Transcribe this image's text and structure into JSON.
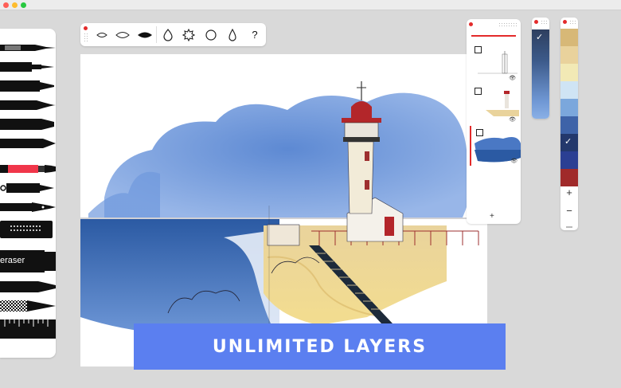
{
  "window": {
    "traffic_lights": [
      "close",
      "minimize",
      "zoom"
    ]
  },
  "brush_toolbar": {
    "brushes": [
      "brush-leaf-small-icon",
      "brush-leaf-outline-icon",
      "brush-leaf-filled-icon",
      "brush-drop-icon",
      "brush-splat-icon",
      "brush-circle-icon",
      "brush-teardrop-icon"
    ],
    "help_label": "?"
  },
  "tools": {
    "items": [
      "fineliner-icon",
      "technical-pen-icon",
      "marker-icon",
      "brush-pen-icon",
      "felt-tip-icon",
      "pencil-icon",
      "watercolor-brush-icon",
      "fountain-pen-icon",
      "nib-pen-icon",
      "texture-brush-icon",
      "eraser-icon",
      "chisel-marker-icon",
      "knife-icon",
      "ruler-icon"
    ],
    "eraser_label": "eraser",
    "active_color": "#f0364a"
  },
  "layers": {
    "add_label": "+"
  },
  "swatches": {
    "colors": [
      "#d7b877",
      "#e9d29c",
      "#f2e9b5",
      "#cfe4f4",
      "#7ba7dc",
      "#3e63a8",
      "#23386c",
      "#2b3f93",
      "#a02a2a"
    ],
    "selected_index": 6,
    "plus_label": "+",
    "minus_label": "−"
  },
  "banner": {
    "text": "UNLIMITED LAYERS",
    "color": "#5b7ff0"
  }
}
